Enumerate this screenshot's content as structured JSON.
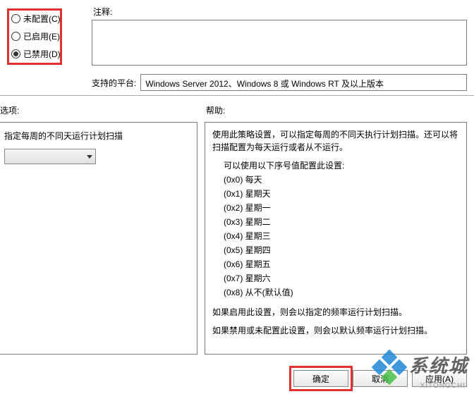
{
  "config_state": {
    "not_configured": {
      "label": "未配置(C)",
      "selected": false
    },
    "enabled": {
      "label": "已启用(E)",
      "selected": false
    },
    "disabled": {
      "label": "已禁用(D)",
      "selected": true
    }
  },
  "comment": {
    "label": "注释:",
    "value": ""
  },
  "platform": {
    "label": "支持的平台:",
    "value": "Windows Server 2012、Windows 8 或 Windows RT 及以上版本"
  },
  "options": {
    "label": "选项:",
    "description": "指定每周的不同天运行计划扫描",
    "selected_value": ""
  },
  "help": {
    "label": "帮助:",
    "intro": "使用此策略设置，可以指定每周的不同天执行计划扫描。还可以将扫描配置为每天运行或者从不运行。",
    "list_intro": "可以使用以下序号值配置此设置:",
    "values": [
      "(0x0) 每天",
      "(0x1) 星期天",
      "(0x2) 星期一",
      "(0x3) 星期二",
      "(0x4) 星期三",
      "(0x5) 星期四",
      "(0x6) 星期五",
      "(0x7) 星期六",
      "(0x8) 从不(默认值)"
    ],
    "enabled_note": "如果启用此设置，则会以指定的频率运行计划扫描。",
    "disabled_note": "如果禁用或未配置此设置，则会以默认频率运行计划扫描。"
  },
  "buttons": {
    "ok": "确定",
    "cancel": "取消",
    "apply": "应用(A)"
  },
  "watermark": {
    "text": "系统城",
    "sub": "XITONGCHI"
  }
}
